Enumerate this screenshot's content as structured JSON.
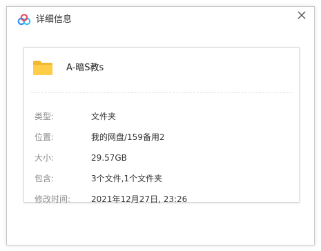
{
  "window": {
    "title": "详细信息",
    "close_glyph": "×",
    "app_icon": "baidu-netdisk-cloud-icon",
    "accent": "#3a8ee6"
  },
  "item": {
    "icon": "folder-icon",
    "icon_color": "#f5c242",
    "name": "A-暗S教s"
  },
  "details": [
    {
      "label": "类型:",
      "value": "文件夹"
    },
    {
      "label": "位置:",
      "value": "我的网盘/159备用2"
    },
    {
      "label": "大小:",
      "value": "29.57GB"
    },
    {
      "label": "包含:",
      "value": "3个文件,1个文件夹"
    },
    {
      "label": "修改时间:",
      "value": "2021年12月27日, 23:26"
    }
  ]
}
